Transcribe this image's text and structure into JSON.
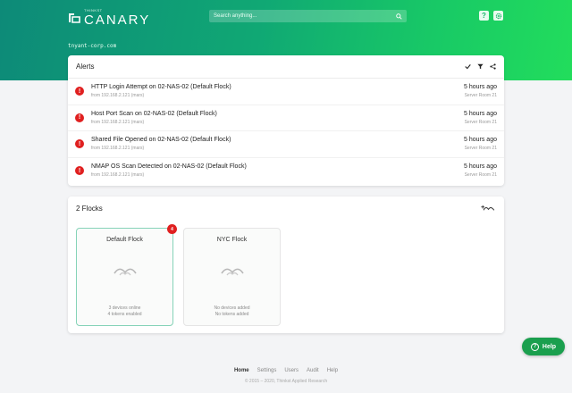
{
  "brand": {
    "small": "THINKST",
    "name": "CANARY"
  },
  "search": {
    "placeholder": "Search anything..."
  },
  "topbar": {
    "help_icon_glyph": "?",
    "settings_icon": "gear-icon"
  },
  "org_domain": "tnyant-corp.com",
  "alerts": {
    "title": "Alerts",
    "items": [
      {
        "title": "HTTP Login Attempt on 02-NAS-02 (Default Flock)",
        "source": "from 192.168.2.121 (mars)",
        "time": "5 hours ago",
        "location": "Server Room 21"
      },
      {
        "title": "Host Port Scan on 02-NAS-02 (Default Flock)",
        "source": "from 192.168.2.121 (mars)",
        "time": "5 hours ago",
        "location": "Server Room 21"
      },
      {
        "title": "Shared File Opened on 02-NAS-02 (Default Flock)",
        "source": "from 192.168.2.121 (mars)",
        "time": "5 hours ago",
        "location": "Server Room 21"
      },
      {
        "title": "NMAP OS Scan Detected on 02-NAS-02 (Default Flock)",
        "source": "from 192.168.2.121 (mars)",
        "time": "5 hours ago",
        "location": "Server Room 21"
      }
    ]
  },
  "flocks": {
    "title": "2 Flocks",
    "items": [
      {
        "name": "Default Flock",
        "line1": "3 devices online",
        "line2": "4 tokens enabled",
        "badge": "4"
      },
      {
        "name": "NYC Flock",
        "line1": "No devices added",
        "line2": "No tokens added"
      }
    ]
  },
  "help_button": "Help",
  "footer": {
    "links": [
      "Home",
      "Settings",
      "Users",
      "Audit",
      "Help"
    ],
    "copyright": "© 2015 – 2020, Thinkst Applied Research"
  },
  "colors": {
    "brand_green": "#18c966",
    "alert_red": "#e02020",
    "help_green": "#1a9f4e"
  }
}
